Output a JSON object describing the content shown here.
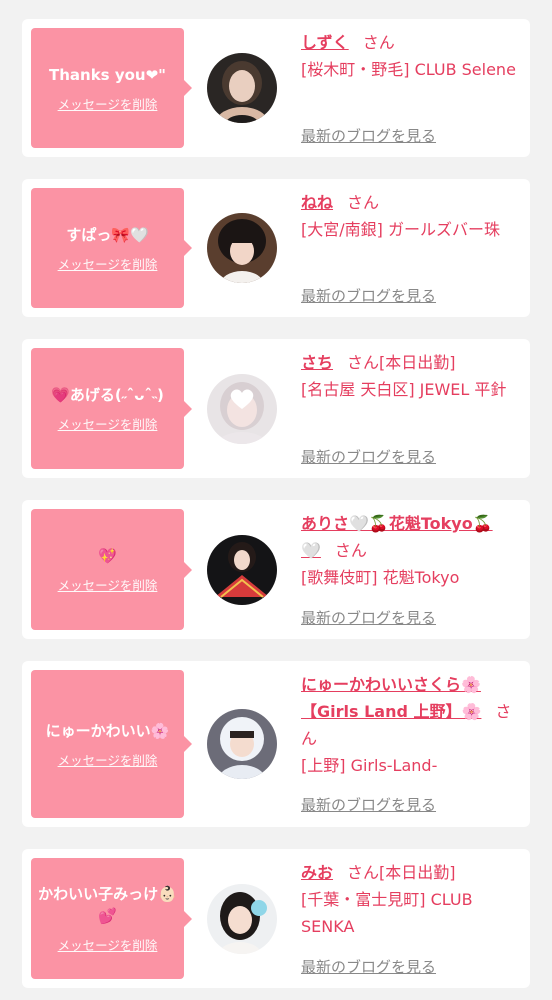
{
  "delete_label": "メッセージを削除",
  "blog_label": "最新のブログを見る",
  "honorific": "さん",
  "entries": [
    {
      "message": "Thanks you❤\"",
      "name": "しずく",
      "badge": "",
      "store": "[桜木町・野毛] CLUB Selene"
    },
    {
      "message": "すぱっ🎀🤍",
      "name": "ねね",
      "badge": "",
      "store": "[大宮/南銀] ガールズバー珠"
    },
    {
      "message": "💗あげる(˶ˆᴗˆ˵)",
      "name": "さち",
      "badge": "[本日出勤]",
      "store": "[名古屋 天白区] JEWEL 平針"
    },
    {
      "message": "💖",
      "name": "ありさ🤍🍒花魁Tokyo🍒🤍",
      "badge": "",
      "store": "[歌舞伎町] 花魁Tokyo"
    },
    {
      "message": "にゅーかわいい🌸",
      "name": "にゅーかわいいさくら🌸【Girls Land 上野】🌸",
      "badge": "",
      "store": "[上野] Girls-Land-"
    },
    {
      "message": "かわいい子みっけ👶🏻💕",
      "name": "みお",
      "badge": "[本日出勤]",
      "store": "[千葉・富士見町] CLUB SENKA"
    }
  ]
}
